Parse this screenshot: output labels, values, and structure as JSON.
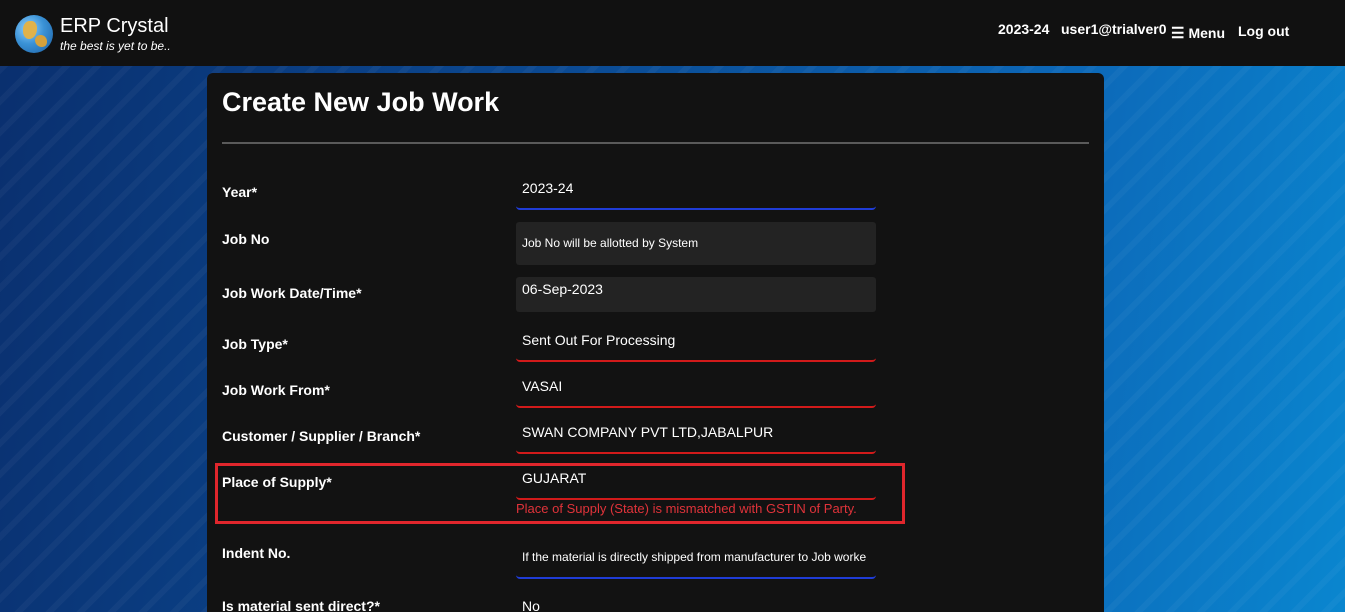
{
  "header": {
    "brand_title": "ERP Crystal",
    "brand_tagline": "the best is yet to be..",
    "year": "2023-24",
    "user": "user1@trialver0",
    "menu_label": "Menu",
    "logout_label": "Log out"
  },
  "page": {
    "title": "Create New Job Work"
  },
  "form": {
    "year": {
      "label": "Year*",
      "value": "2023-24"
    },
    "job_no": {
      "label": "Job No",
      "value": "Job No will be allotted by System"
    },
    "job_work_date": {
      "label": "Job Work Date/Time*",
      "value": "06-Sep-2023"
    },
    "job_type": {
      "label": "Job Type*",
      "value": "Sent Out For Processing"
    },
    "job_work_from": {
      "label": "Job Work From*",
      "value": "VASAI"
    },
    "customer": {
      "label": "Customer / Supplier / Branch*",
      "value": "SWAN COMPANY PVT LTD,JABALPUR"
    },
    "place_of_supply": {
      "label": "Place of Supply*",
      "value": "GUJARAT",
      "error": "Place of Supply (State) is mismatched with GSTIN of Party."
    },
    "indent_no": {
      "label": "Indent No.",
      "placeholder": "If the material is directly shipped from manufacturer to Job worke"
    },
    "material_sent_direct": {
      "label": "Is material sent direct?*",
      "value": "No"
    }
  },
  "colors": {
    "error_red": "#e0262c",
    "focus_blue": "#1f3cd6",
    "invalid_red": "#d11a1a"
  }
}
